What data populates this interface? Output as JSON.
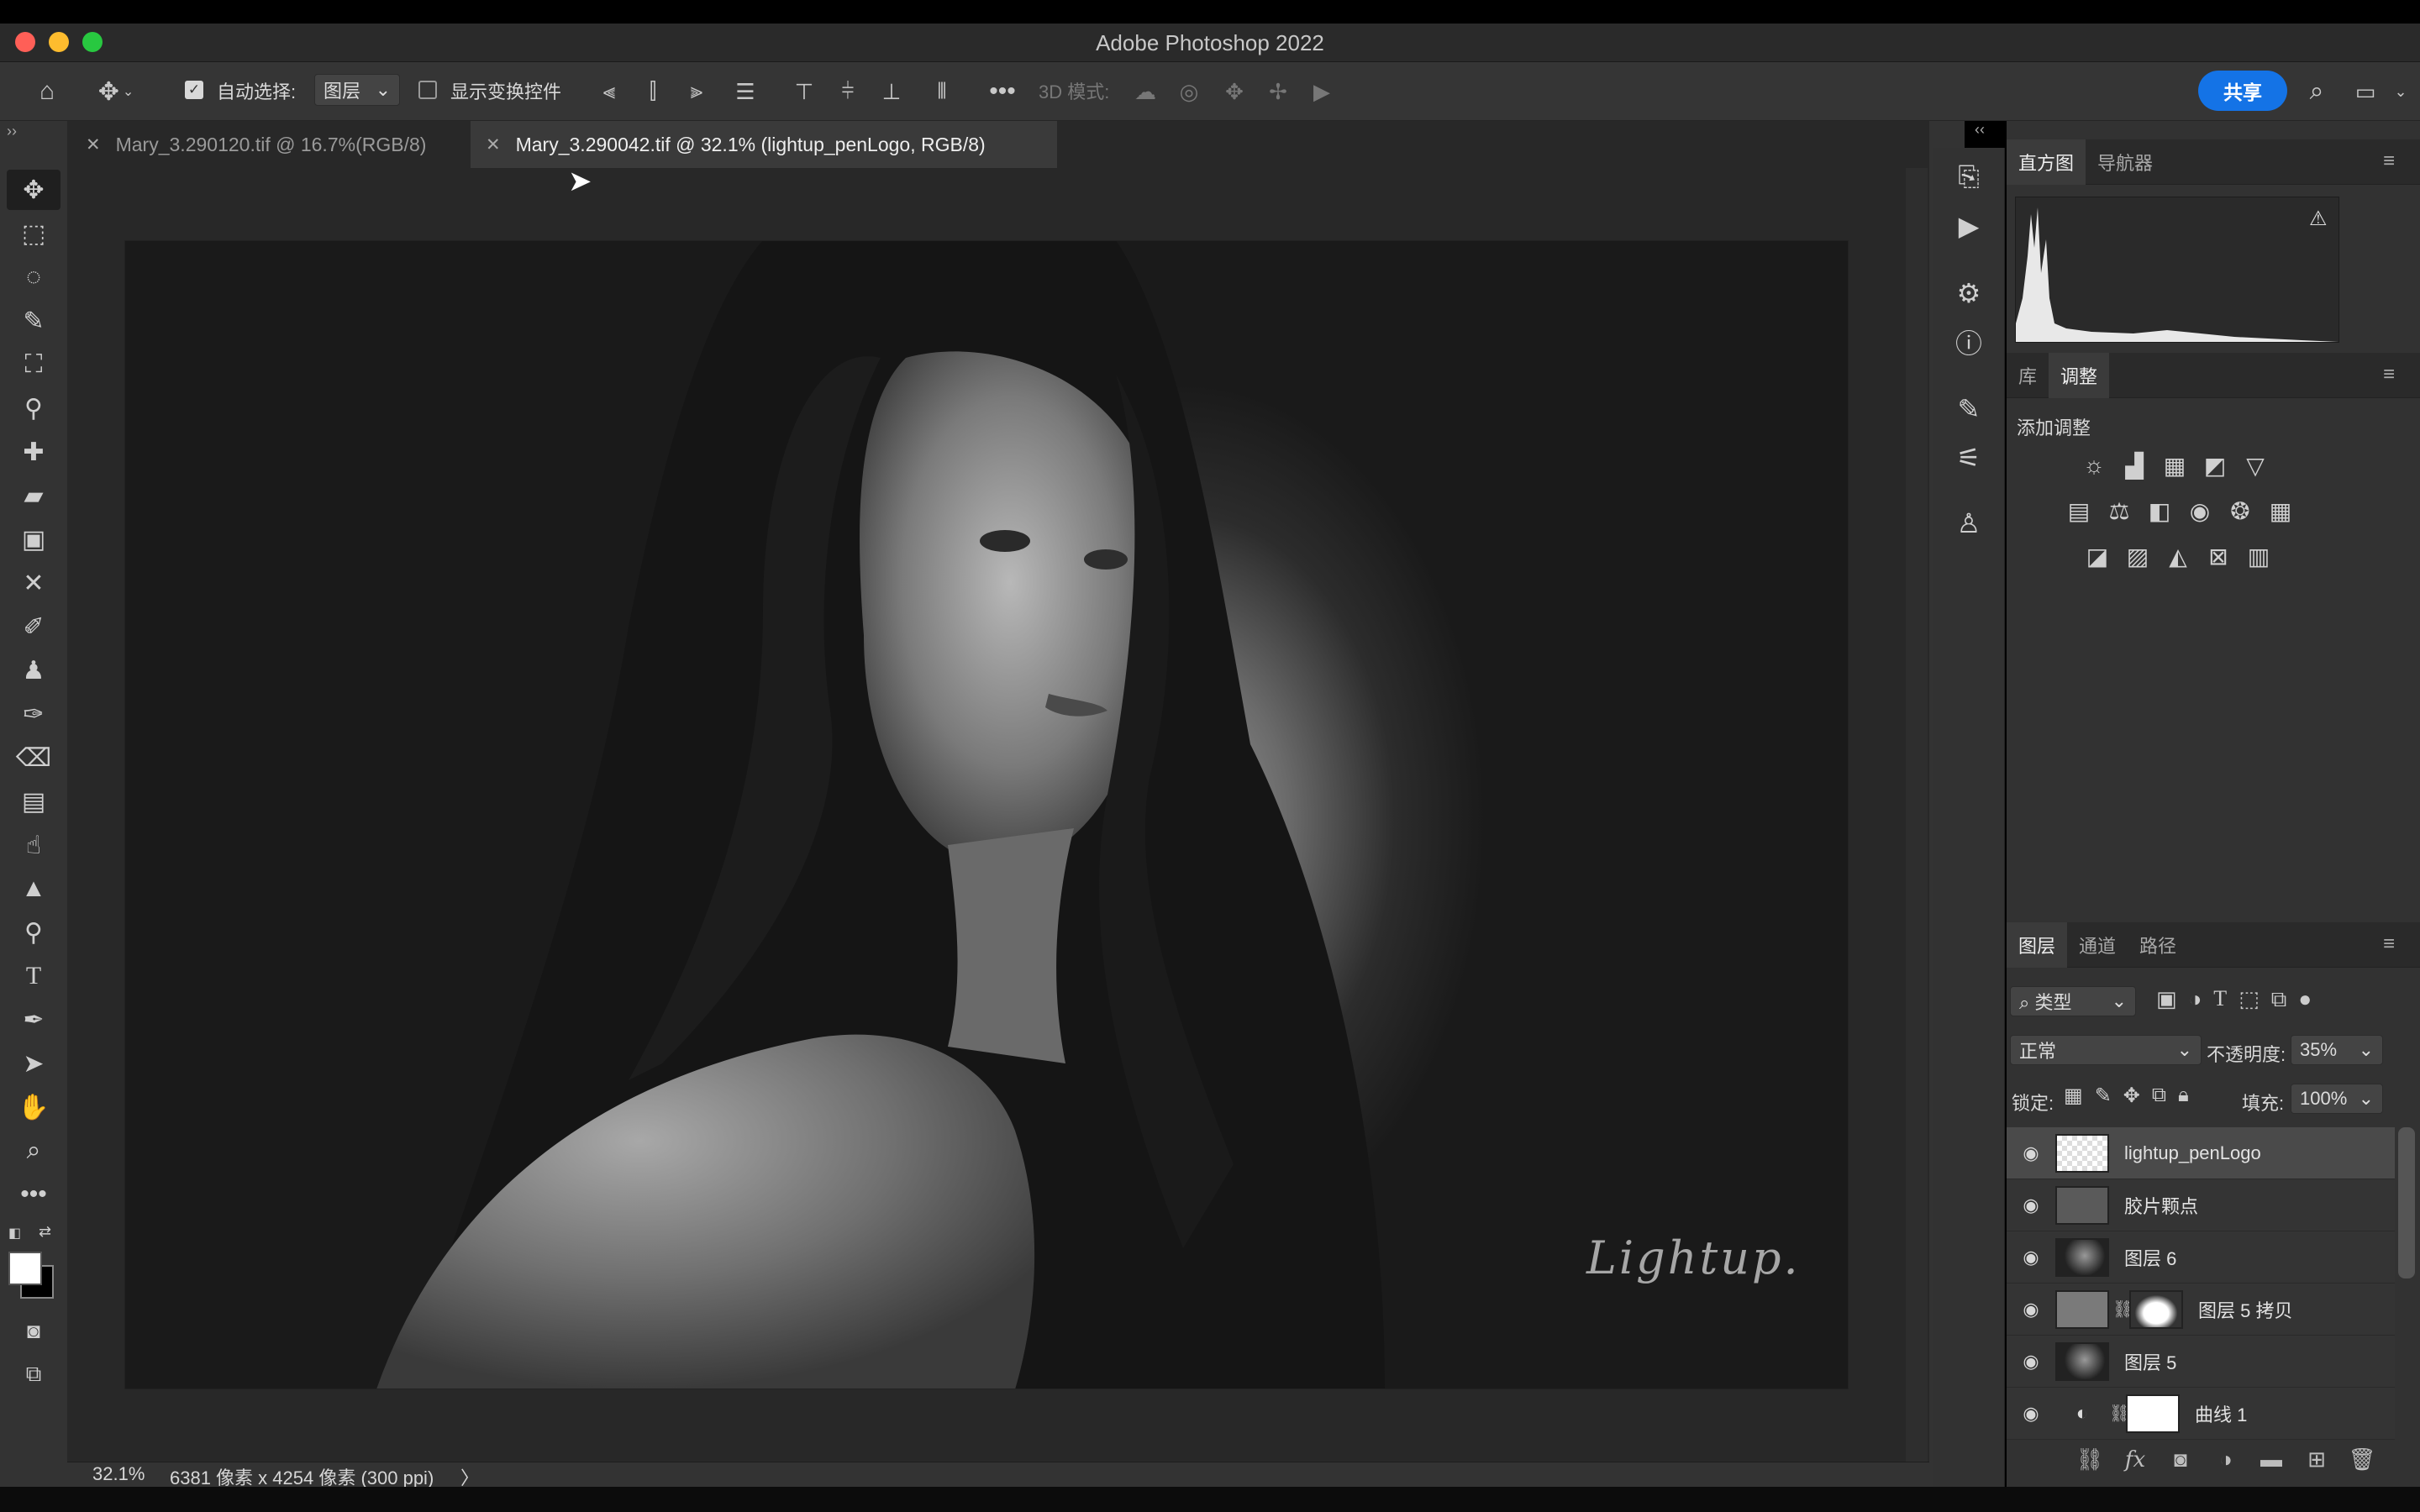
{
  "app": {
    "title": "Adobe Photoshop 2022"
  },
  "options": {
    "auto_select_label": "自动选择:",
    "auto_select_value": "图层",
    "show_transform_label": "显示变换控件",
    "mode_3d_label": "3D 模式:",
    "share_label": "共享"
  },
  "tabs": [
    {
      "label": "Mary_3.290120.tif @ 16.7%(RGB/8)",
      "active": false
    },
    {
      "label": "Mary_3.290042.tif @ 32.1% (lightup_penLogo, RGB/8)",
      "active": true
    }
  ],
  "status": {
    "zoom": "32.1%",
    "doc_info": "6381 像素 x 4254 像素 (300 ppi)",
    "arrow": "〉"
  },
  "canvas": {
    "watermark": "Lightup."
  },
  "histogram_panel": {
    "tabs": [
      "直方图",
      "导航器"
    ],
    "warning": "⚠"
  },
  "adjust_panel": {
    "tabs": [
      "库",
      "调整"
    ],
    "add_label": "添加调整"
  },
  "layers_panel": {
    "tabs": [
      "图层",
      "通道",
      "路径"
    ],
    "filter_label": "类型",
    "blend_mode": "正常",
    "opacity_label": "不透明度:",
    "opacity_value": "35%",
    "lock_label": "锁定:",
    "fill_label": "填充:",
    "fill_value": "100%",
    "layers": [
      {
        "name": "lightup_penLogo",
        "selected": true
      },
      {
        "name": "胶片颗点",
        "selected": false
      },
      {
        "name": "图层 6",
        "selected": false
      },
      {
        "name": "图层 5 拷贝",
        "selected": false
      },
      {
        "name": "图层 5",
        "selected": false
      },
      {
        "name": "曲线 1",
        "selected": false
      }
    ]
  },
  "colors": {
    "accent": "#1473e6",
    "panel": "#323232",
    "canvas_bg": "#282828"
  }
}
